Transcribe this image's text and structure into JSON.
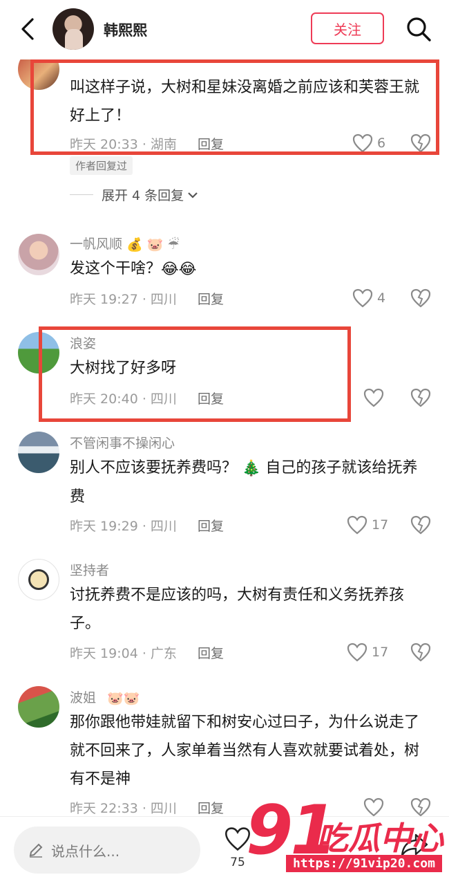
{
  "header": {
    "name": "韩熙熙",
    "follow_label": "关注"
  },
  "comments": [
    {
      "name": "",
      "text": "叫这样子说，大树和星妹没离婚之前应该和芙蓉王就好上了！",
      "time": "昨天 20:33 · 湖南",
      "reply_label": "回复",
      "likes": "6",
      "author_tag": "作者回复过",
      "expand_label": "展开 4 条回复"
    },
    {
      "name": "一帆风顺",
      "text": "发这个干啥？",
      "time": "昨天 19:27 · 四川",
      "reply_label": "回复",
      "likes": "4"
    },
    {
      "name": "浪姿",
      "text": "大树找了好多呀",
      "time": "昨天 20:40 · 四川",
      "reply_label": "回复",
      "likes": ""
    },
    {
      "name": "不管闲事不操闲心",
      "text_a": "别人不应该要抚养费吗？",
      "text_b": "自己的孩子就该给抚养费",
      "time": "昨天 19:29 · 四川",
      "reply_label": "回复",
      "likes": "17"
    },
    {
      "name": "坚持者",
      "text": "讨抚养费不是应该的吗，大树有责任和义务抚养孩子。",
      "time": "昨天 19:04 · 广东",
      "reply_label": "回复",
      "likes": "17"
    },
    {
      "name": "波姐",
      "text": "那你跟他带娃就留下和树安心过曰子，为什么说走了就不回来了，人家单着当然有人喜欢就要试着处，树有不是神",
      "time": "昨天 22:33 · 四川",
      "reply_label": "回复",
      "likes": ""
    }
  ],
  "bottom": {
    "input_placeholder": "说点什么...",
    "like_count": "75"
  },
  "watermark": {
    "number": "91",
    "text": "吃瓜中心",
    "url": "https://91vip20.com"
  },
  "colors": {
    "accent": "#ee3b56",
    "highlight": "#e8463a"
  },
  "icons": [
    "back-arrow-icon",
    "search-icon",
    "heart-icon",
    "dislike-heart-icon",
    "pencil-icon",
    "share-icon"
  ]
}
